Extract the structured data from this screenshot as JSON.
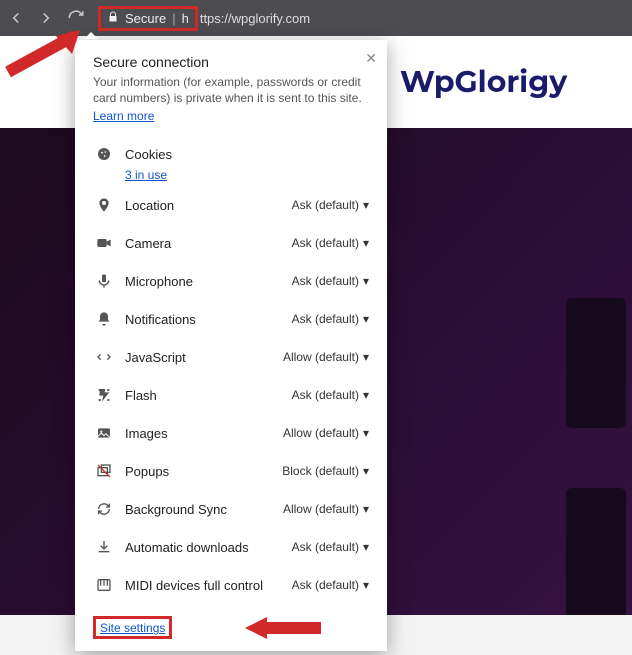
{
  "addrBar": {
    "secureLabel": "Secure",
    "urlPrefix": "h",
    "urlRest": "ttps://wpglorify.com"
  },
  "brandLabel": "WpGlorigy",
  "popup": {
    "title": "Secure connection",
    "body": "Your information (for example, passwords or credit card numbers) is private when it is sent to this site.",
    "learnMore": "Learn more",
    "cookies": {
      "label": "Cookies",
      "sub": "3 in use"
    },
    "perms": [
      {
        "icon": "location",
        "label": "Location",
        "value": "Ask (default)"
      },
      {
        "icon": "camera",
        "label": "Camera",
        "value": "Ask (default)"
      },
      {
        "icon": "mic",
        "label": "Microphone",
        "value": "Ask (default)"
      },
      {
        "icon": "bell",
        "label": "Notifications",
        "value": "Ask (default)"
      },
      {
        "icon": "js",
        "label": "JavaScript",
        "value": "Allow (default)"
      },
      {
        "icon": "flash",
        "label": "Flash",
        "value": "Ask (default)"
      },
      {
        "icon": "images",
        "label": "Images",
        "value": "Allow (default)"
      },
      {
        "icon": "popup",
        "label": "Popups",
        "value": "Block (default)"
      },
      {
        "icon": "sync",
        "label": "Background Sync",
        "value": "Allow (default)"
      },
      {
        "icon": "download",
        "label": "Automatic downloads",
        "value": "Ask (default)"
      },
      {
        "icon": "midi",
        "label": "MIDI devices full control",
        "value": "Ask (default)"
      }
    ],
    "siteSettings": "Site settings"
  }
}
